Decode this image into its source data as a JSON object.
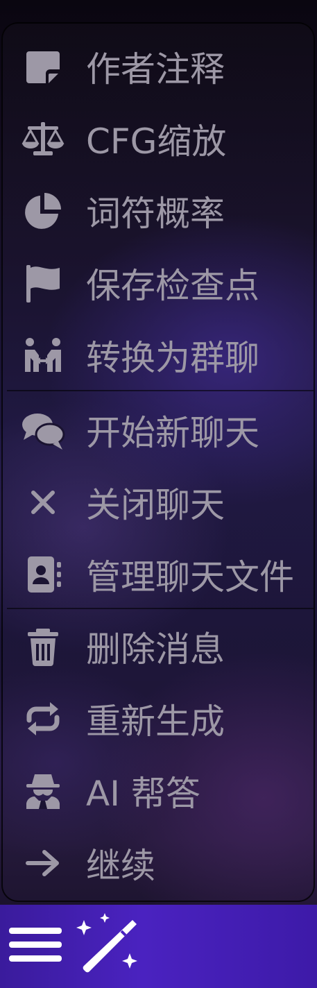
{
  "menu": {
    "items": [
      {
        "label": "作者注释",
        "icon": "sticky-note-icon"
      },
      {
        "label": "CFG缩放",
        "icon": "scale-balanced-icon"
      },
      {
        "label": "词符概率",
        "icon": "pie-chart-icon"
      },
      {
        "label": "保存检查点",
        "icon": "flag-icon"
      },
      {
        "label": "转换为群聊",
        "icon": "people-arrows-icon"
      },
      {
        "label": "开始新聊天",
        "icon": "comments-icon"
      },
      {
        "label": "关闭聊天",
        "icon": "close-icon"
      },
      {
        "label": "管理聊天文件",
        "icon": "address-book-icon"
      },
      {
        "label": "删除消息",
        "icon": "trash-icon"
      },
      {
        "label": "重新生成",
        "icon": "repeat-icon"
      },
      {
        "label": "AI 帮答",
        "icon": "user-secret-icon"
      },
      {
        "label": "继续",
        "icon": "arrow-right-icon"
      }
    ]
  },
  "bottom_bar": {
    "left_button": "hamburger-menu-icon",
    "right_button": "magic-wand-icon"
  },
  "colors": {
    "icon": "#9d98a6",
    "label": "#9d98a6",
    "bottom_bar": "#4a22c0"
  }
}
